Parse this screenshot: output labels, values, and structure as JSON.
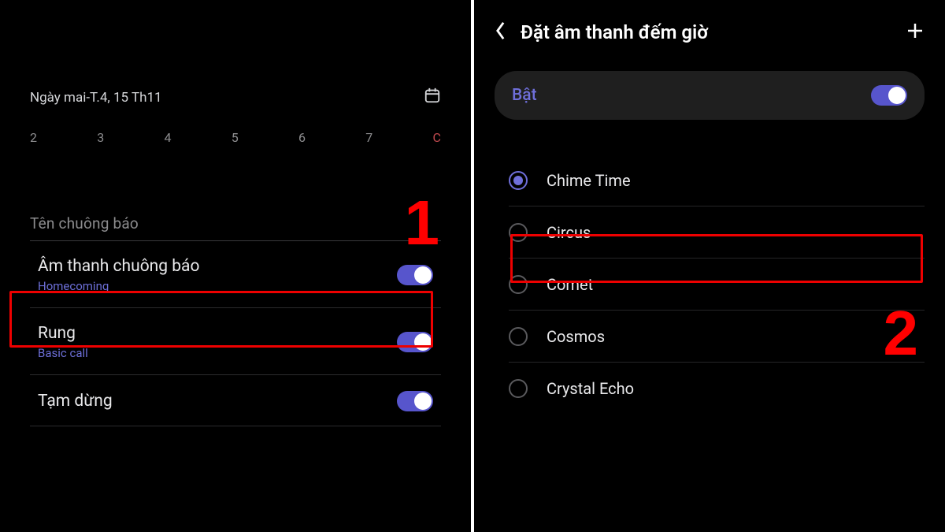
{
  "left_screen": {
    "date_label": "Ngày mai-T.4, 15 Th11",
    "days": [
      "2",
      "3",
      "4",
      "5",
      "6",
      "7",
      "C"
    ],
    "alarm_name_placeholder": "Tên chuông báo",
    "settings": [
      {
        "label": "Âm thanh chuông báo",
        "sub": "Homecoming",
        "on": true
      },
      {
        "label": "Rung",
        "sub": "Basic call",
        "on": true
      },
      {
        "label": "Tạm dừng",
        "sub": "",
        "on": true
      }
    ],
    "step_number": "1"
  },
  "right_screen": {
    "title": "Đặt âm thanh đếm giờ",
    "enable_label": "Bật",
    "enable_on": true,
    "sounds": [
      {
        "name": "Chime Time",
        "selected": true
      },
      {
        "name": "Circus",
        "selected": false
      },
      {
        "name": "Comet",
        "selected": false
      },
      {
        "name": "Cosmos",
        "selected": false
      },
      {
        "name": "Crystal Echo",
        "selected": false
      }
    ],
    "step_number": "2"
  }
}
